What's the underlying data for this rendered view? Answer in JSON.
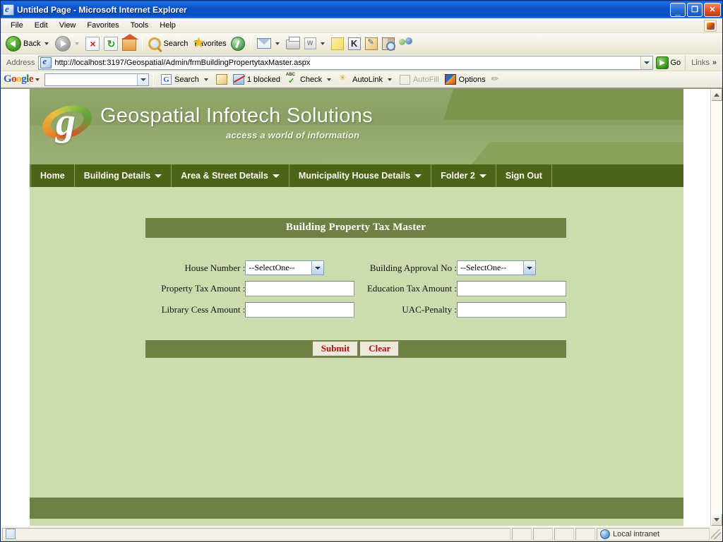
{
  "window": {
    "title": "Untitled Page - Microsoft Internet Explorer",
    "icon": "ie-page-icon",
    "minimize_label": "_",
    "restore_label": "❐",
    "close_label": "✕"
  },
  "menubar": {
    "items": [
      {
        "label": "File"
      },
      {
        "label": "Edit"
      },
      {
        "label": "View"
      },
      {
        "label": "Favorites"
      },
      {
        "label": "Tools"
      },
      {
        "label": "Help"
      }
    ]
  },
  "toolbar": {
    "back_label": "Back",
    "search_label": "Search",
    "favorites_label": "Favorites",
    "icons": [
      "back-icon",
      "forward-icon",
      "stop-icon",
      "refresh-icon",
      "home-icon",
      "search-icon",
      "favorites-star-icon",
      "media-icon",
      "mail-icon",
      "print-icon",
      "edit-word-icon",
      "notes-icon",
      "messenger-k-icon",
      "research-icon",
      "encarta-icon",
      "people-icon"
    ]
  },
  "address": {
    "label": "Address",
    "url": "http://localhost:3197/Geospatial/Admin/frmBuildingPropertytaxMaster.aspx",
    "go_label": "Go",
    "links_label": "Links",
    "links_chevron": "»"
  },
  "google_toolbar": {
    "logo_letters": [
      "G",
      "o",
      "o",
      "g",
      "l",
      "e"
    ],
    "search_value": "",
    "search_label": "Search",
    "blocked_label": "1 blocked",
    "check_label": "Check",
    "autolink_label": "AutoLink",
    "autofill_label": "AutoFill",
    "options_label": "Options"
  },
  "site": {
    "brand_title": "Geospatial Infotech Solutions",
    "brand_tagline": "access a world of information",
    "logo_letter": "g",
    "nav": [
      {
        "label": "Home",
        "has_arrow": false
      },
      {
        "label": "Building Details",
        "has_arrow": true
      },
      {
        "label": "Area & Street Details",
        "has_arrow": true
      },
      {
        "label": "Municipality House Details",
        "has_arrow": true
      },
      {
        "label": "Folder 2",
        "has_arrow": true
      },
      {
        "label": "Sign Out",
        "has_arrow": false
      }
    ],
    "panel_title": "Building Property Tax Master",
    "fields": {
      "house_number_label": "House Number :",
      "house_number_value": "--SelectOne--",
      "building_approval_label": "Building Approval No :",
      "building_approval_value": "--SelectOne--",
      "property_tax_label": "Property Tax Amount :",
      "property_tax_value": "",
      "education_tax_label": "Education Tax Amount :",
      "education_tax_value": "",
      "library_cess_label": "Library Cess Amount :",
      "library_cess_value": "",
      "uac_penalty_label": "UAC-Penalty :",
      "uac_penalty_value": ""
    },
    "buttons": {
      "submit_label": "Submit",
      "clear_label": "Clear"
    }
  },
  "statusbar": {
    "message": "",
    "zone_label": "Local intranet"
  },
  "colors": {
    "titlebar_blue": "#0b52c8",
    "nav_dark_green": "#4c6318",
    "panel_green": "#6f8043",
    "page_green": "#cddcaf",
    "header_green": "#8b9f62",
    "button_text_red": "#aa1111"
  }
}
